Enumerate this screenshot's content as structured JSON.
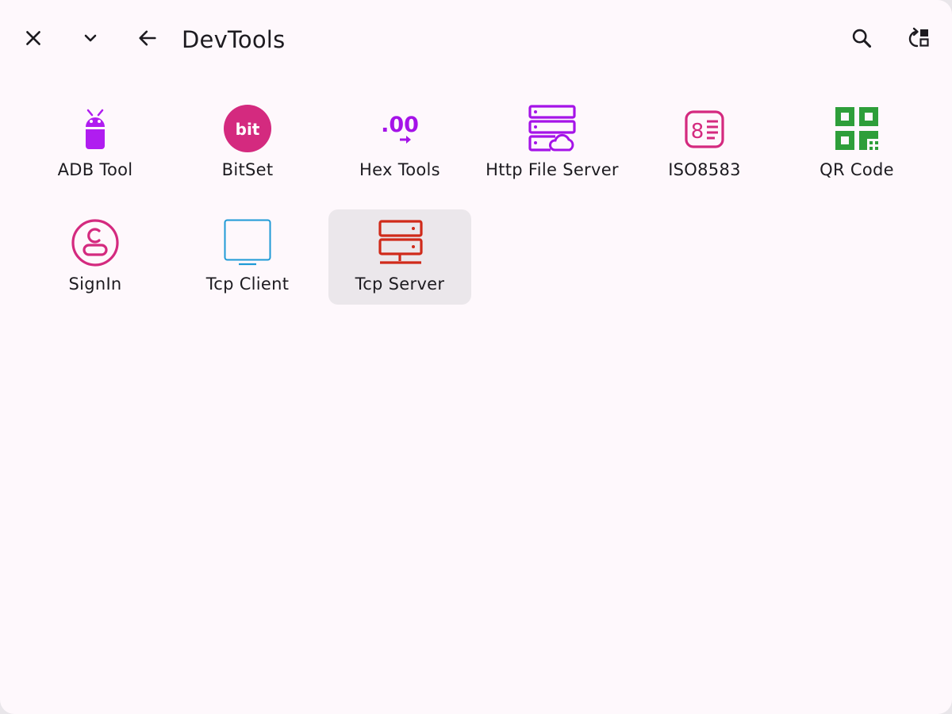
{
  "window": {
    "title": "DevTools"
  },
  "toolbar": {
    "close_icon": "close-icon",
    "dropdown_icon": "chevron-down-icon",
    "back_icon": "arrow-back-icon",
    "search_icon": "search-icon",
    "switch_icon": "switch-layout-icon"
  },
  "tools": [
    {
      "label": "ADB Tool",
      "icon": "android-icon",
      "color": "#b01df0"
    },
    {
      "label": "BitSet",
      "icon": "bit-icon",
      "color": "#d42a7f"
    },
    {
      "label": "Hex Tools",
      "icon": "decimal-hex-icon",
      "color": "#a513e8"
    },
    {
      "label": "Http File Server",
      "icon": "cloud-server-icon",
      "color": "#a513e8"
    },
    {
      "label": "ISO8583",
      "icon": "iso-card-icon",
      "color": "#d42a7f"
    },
    {
      "label": "QR Code",
      "icon": "qr-code-icon",
      "color": "#2e9e3a"
    },
    {
      "label": "SignIn",
      "icon": "sign-in-icon",
      "color": "#d42a7f"
    },
    {
      "label": "Tcp Client",
      "icon": "monitor-icon",
      "color": "#1e9ad6"
    },
    {
      "label": "Tcp Server",
      "icon": "server-icon",
      "color": "#d02a1a"
    }
  ],
  "selected_tool": "Tcp Server"
}
